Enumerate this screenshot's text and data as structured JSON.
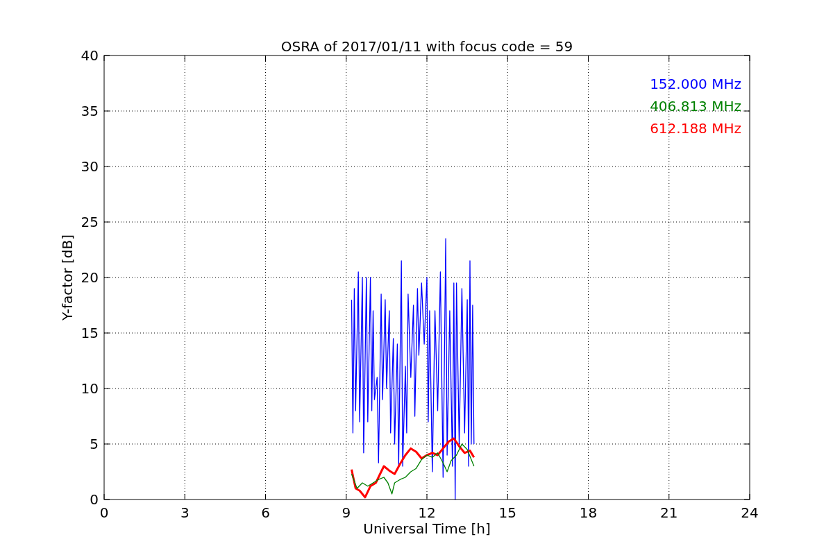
{
  "chart_data": {
    "type": "line",
    "title": "OSRA of 2017/01/11 with focus code = 59",
    "xlabel": "Universal Time [h]",
    "ylabel": "Y-factor [dB]",
    "xlim": [
      0,
      24
    ],
    "ylim": [
      0,
      40
    ],
    "grid": true,
    "xticks": [
      0,
      3,
      6,
      9,
      12,
      15,
      18,
      21,
      24
    ],
    "yticks": [
      0,
      5,
      10,
      15,
      20,
      25,
      30,
      35,
      40
    ],
    "series": [
      {
        "name": "152.000 MHz",
        "color": "#0000ff",
        "x": [
          9.2,
          9.25,
          9.3,
          9.35,
          9.45,
          9.5,
          9.6,
          9.65,
          9.75,
          9.8,
          9.9,
          9.95,
          10.0,
          10.05,
          10.15,
          10.2,
          10.3,
          10.35,
          10.45,
          10.5,
          10.6,
          10.65,
          10.75,
          10.8,
          10.9,
          10.95,
          11.05,
          11.1,
          11.2,
          11.25,
          11.3,
          11.4,
          11.5,
          11.55,
          11.65,
          11.7,
          11.8,
          11.9,
          12.0,
          12.05,
          12.1,
          12.2,
          12.3,
          12.4,
          12.5,
          12.6,
          12.7,
          12.75,
          12.85,
          12.95,
          13.0,
          13.05,
          13.1,
          13.2,
          13.3,
          13.4,
          13.5,
          13.55,
          13.6,
          13.65,
          13.7,
          13.75
        ],
        "values": [
          18,
          6,
          19,
          8,
          20.5,
          7,
          20,
          4.2,
          20,
          7,
          20,
          8,
          17,
          9,
          11,
          3.3,
          18.5,
          9,
          18,
          10,
          17,
          6,
          14.5,
          5,
          14,
          3,
          21.5,
          3,
          12,
          6,
          18.5,
          11,
          17.5,
          7.5,
          19,
          13,
          19.5,
          14,
          20,
          7,
          17,
          2.5,
          17,
          8,
          20.5,
          2,
          23.5,
          4,
          17,
          3,
          19.5,
          0,
          19.5,
          5,
          19,
          6,
          18,
          3,
          21.5,
          5,
          17.5,
          5
        ]
      },
      {
        "name": "406.813 MHz",
        "color": "#008000",
        "x": [
          9.2,
          9.4,
          9.6,
          9.8,
          10.0,
          10.2,
          10.4,
          10.55,
          10.7,
          10.8,
          11.0,
          11.2,
          11.4,
          11.6,
          11.8,
          12.0,
          12.2,
          12.4,
          12.6,
          12.75,
          12.9,
          13.1,
          13.3,
          13.5,
          13.75
        ],
        "values": [
          2.3,
          1.0,
          1.5,
          1.2,
          1.5,
          1.8,
          2.0,
          1.5,
          0.5,
          1.5,
          1.8,
          2.0,
          2.5,
          2.8,
          3.6,
          4.0,
          3.8,
          4.2,
          3.3,
          2.5,
          3.5,
          4.0,
          5.0,
          4.5,
          3.0
        ]
      },
      {
        "name": "612.188 MHz",
        "color": "#ff0000",
        "x": [
          9.2,
          9.35,
          9.5,
          9.7,
          9.9,
          10.1,
          10.3,
          10.4,
          10.6,
          10.8,
          11.0,
          11.2,
          11.4,
          11.6,
          11.8,
          12.0,
          12.2,
          12.4,
          12.6,
          12.8,
          13.0,
          13.2,
          13.4,
          13.6,
          13.75
        ],
        "values": [
          2.7,
          1.0,
          0.8,
          0.2,
          1.2,
          1.5,
          2.5,
          3.0,
          2.6,
          2.3,
          3.2,
          4.0,
          4.6,
          4.3,
          3.7,
          4.0,
          4.2,
          4.0,
          4.6,
          5.2,
          5.5,
          4.8,
          4.2,
          4.4,
          3.8
        ]
      }
    ]
  }
}
